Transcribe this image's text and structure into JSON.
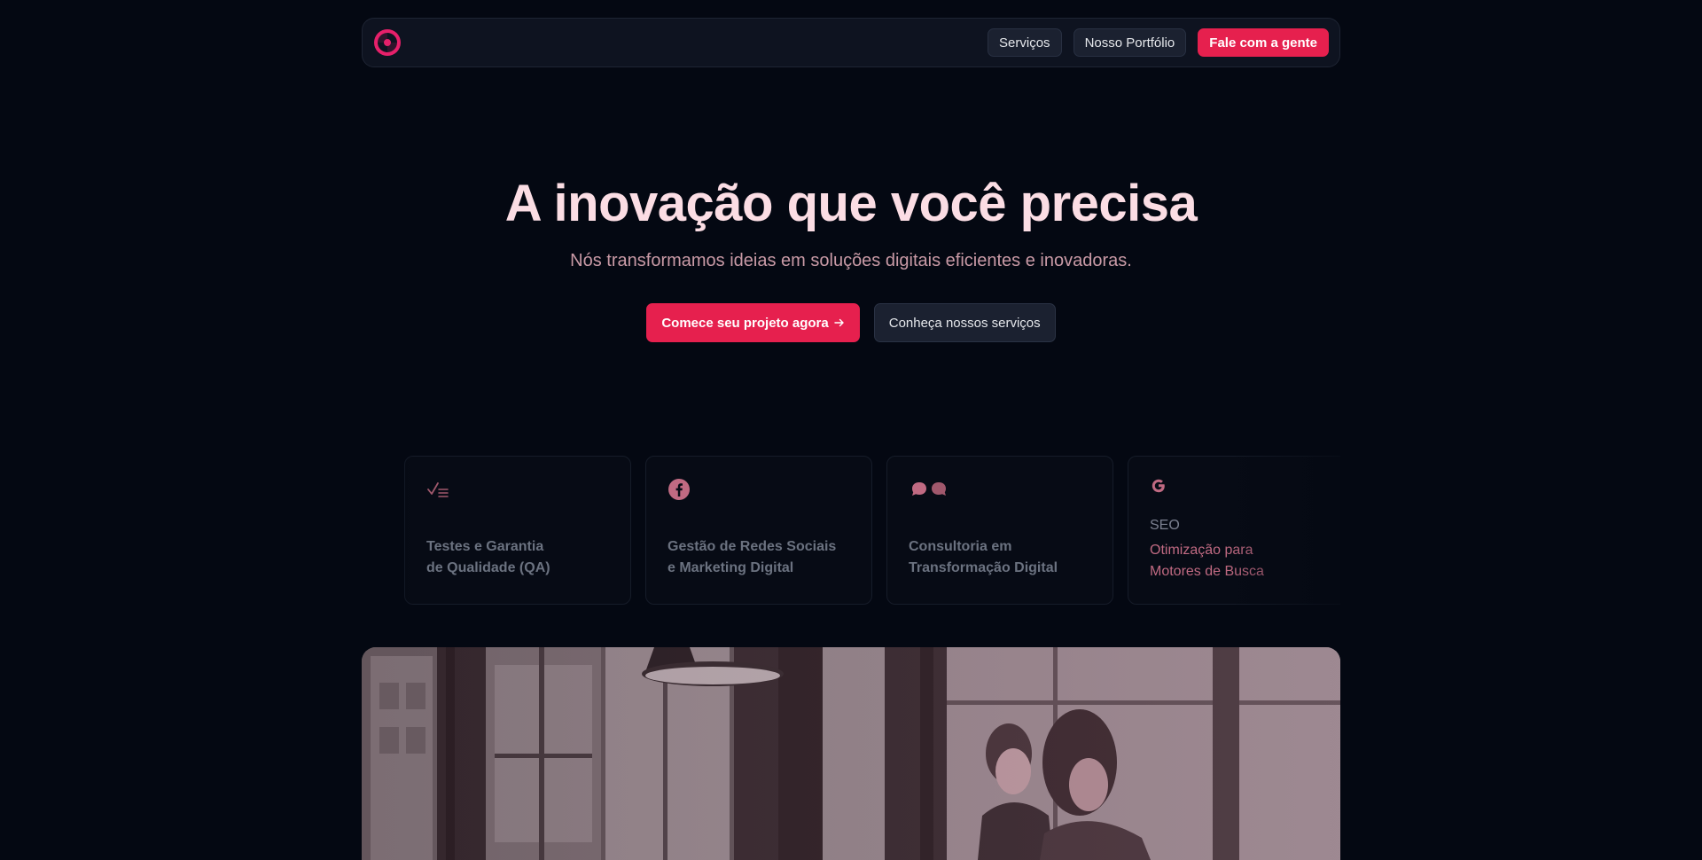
{
  "colors": {
    "accent": "#e6204e",
    "background": "#040812",
    "hero_title": "#fbdde4",
    "hero_subtitle": "#c99aa6"
  },
  "nav": {
    "logo": "brand-swirl-logo",
    "links": [
      {
        "label": "Serviços"
      },
      {
        "label": "Nosso Portfólio"
      }
    ],
    "cta_label": "Fale com a gente"
  },
  "hero": {
    "title": "A inovação que você precisa",
    "subtitle": "Nós transformamos ideias em soluções digitais eficientes e inovadoras.",
    "primary_cta": "Comece seu projeto agora",
    "primary_cta_icon": "arrow-right-icon",
    "secondary_cta": "Conheça nossos serviços"
  },
  "services": [
    {
      "icon": "checklist-icon",
      "title_line1": "Testes e Garantia",
      "title_line2": "de Qualidade (QA)"
    },
    {
      "icon": "facebook-icon",
      "title_line1": "Gestão de Redes Sociais",
      "title_line2": "e Marketing Digital"
    },
    {
      "icon": "chat-bubbles-icon",
      "title_line1": "Consultoria em",
      "title_line2": "Transformação Digital"
    },
    {
      "icon": "google-icon",
      "title": "SEO",
      "desc_line1": "Otimização para",
      "desc_line2": "Motores de Busca"
    }
  ],
  "hero_image": {
    "description_icon": "office-photo"
  }
}
